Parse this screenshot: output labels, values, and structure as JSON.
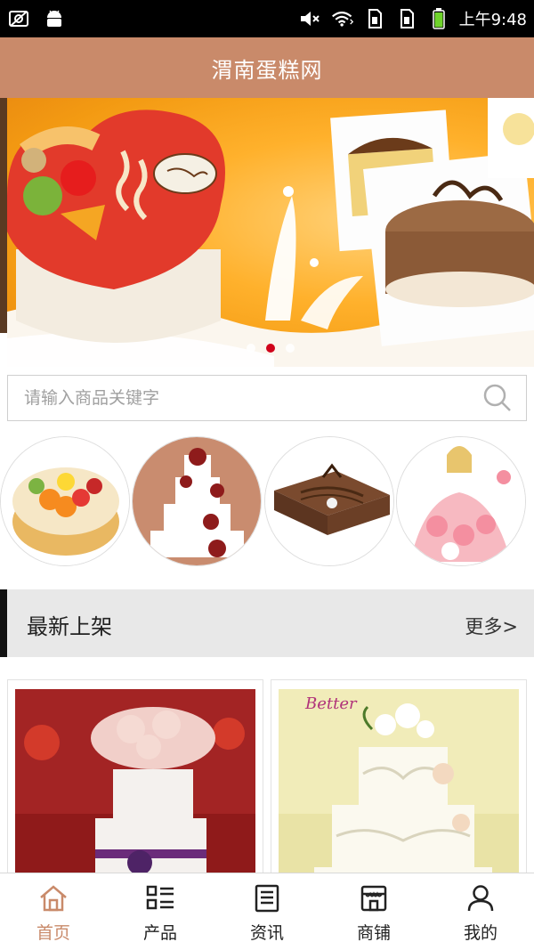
{
  "status_bar": {
    "time": "上午9:48",
    "icons_left": [
      "screenshot-icon",
      "android-icon"
    ],
    "icons_right": [
      "mute-icon",
      "wifi-icon",
      "sim1-icon",
      "sim2-icon",
      "battery-icon"
    ]
  },
  "header": {
    "title": "渭南蛋糕网",
    "background": "#c98a6a"
  },
  "banner": {
    "slides": 3,
    "active_slide": 2,
    "active_color": "#d0021b"
  },
  "search": {
    "placeholder": "请输入商品关键字"
  },
  "categories": [
    {
      "icon": "fruit-cake-image"
    },
    {
      "icon": "tiered-rose-cake-image"
    },
    {
      "icon": "chocolate-mousse-image"
    },
    {
      "icon": "doll-cake-image"
    }
  ],
  "section": {
    "title": "最新上架",
    "more": "更多>"
  },
  "products": [
    {
      "icon": "wedding-cake-flowers-image"
    },
    {
      "icon": "wedding-cake-better-image",
      "label": "Better"
    }
  ],
  "bottom_nav": {
    "items": [
      {
        "label": "首页",
        "icon": "home-icon",
        "active": true
      },
      {
        "label": "产品",
        "icon": "grid-list-icon",
        "active": false
      },
      {
        "label": "资讯",
        "icon": "news-icon",
        "active": false
      },
      {
        "label": "商铺",
        "icon": "shop-icon",
        "active": false
      },
      {
        "label": "我的",
        "icon": "user-icon",
        "active": false
      }
    ],
    "active_color": "#c98a6a"
  }
}
